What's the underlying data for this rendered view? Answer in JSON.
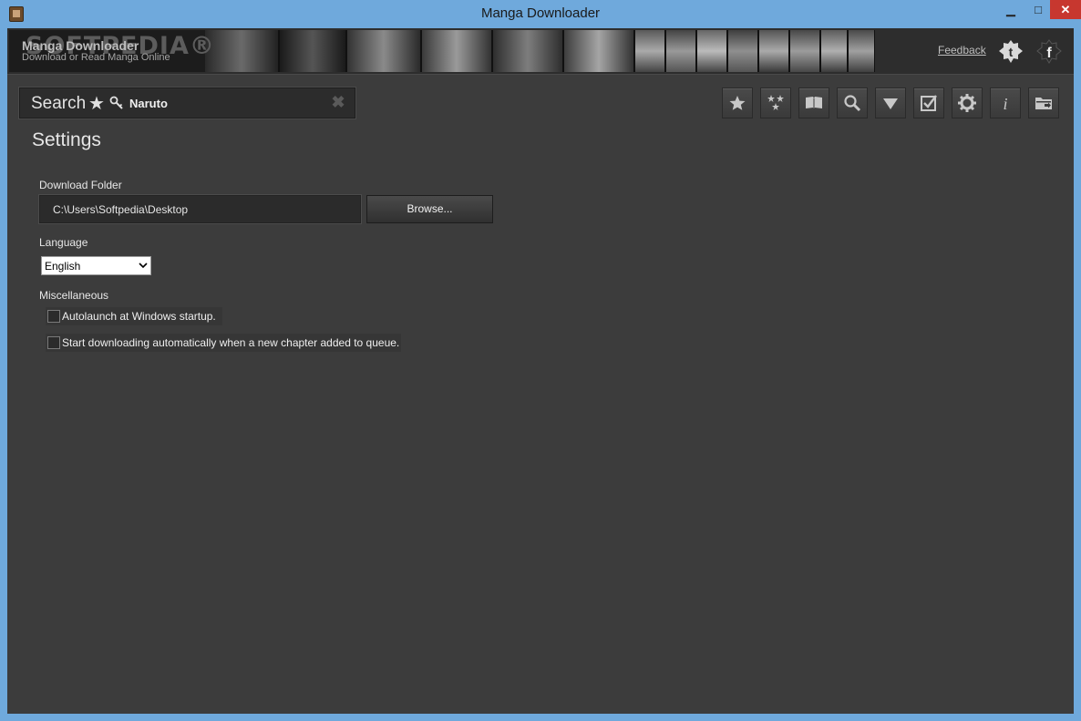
{
  "window": {
    "title": "Manga Downloader",
    "minimize_label": "▁",
    "maximize_label": "□",
    "close_label": "✕",
    "frame_color": "#6fa9dc",
    "background_color": "#3c3c3c"
  },
  "banner": {
    "watermark": "SOFTPEDIA®",
    "brand_title": "Manga Downloader",
    "brand_subtitle": "Download or Read Manga Online",
    "feedback_label": "Feedback",
    "social": [
      "twitter-icon",
      "facebook-icon"
    ]
  },
  "search": {
    "label": "Search",
    "star_icon": "★",
    "key_icon": "key-icon",
    "value": "Naruto",
    "clear_icon": "✖"
  },
  "toolbar": {
    "buttons": [
      {
        "name": "favorites-button",
        "icon": "star-icon"
      },
      {
        "name": "popular-button",
        "icon": "stars-icon"
      },
      {
        "name": "reader-button",
        "icon": "book-icon"
      },
      {
        "name": "search-button",
        "icon": "search-icon"
      },
      {
        "name": "downloads-button",
        "icon": "download-arrow-icon"
      },
      {
        "name": "queue-button",
        "icon": "checklist-icon"
      },
      {
        "name": "settings-button",
        "icon": "gear-icon"
      },
      {
        "name": "about-button",
        "icon": "info-icon"
      },
      {
        "name": "open-folder-button",
        "icon": "folder-icon"
      }
    ]
  },
  "settings": {
    "title": "Settings",
    "download_folder_label": "Download Folder",
    "download_folder_value": "C:\\Users\\Softpedia\\Desktop",
    "browse_label": "Browse...",
    "language_label": "Language",
    "language_value": "English",
    "misc_label": "Miscellaneous",
    "autolaunch_label": "Autolaunch at Windows startup.",
    "autolaunch_checked": false,
    "autodownload_label": "Start downloading automatically when a new chapter added to queue.",
    "autodownload_checked": false
  }
}
